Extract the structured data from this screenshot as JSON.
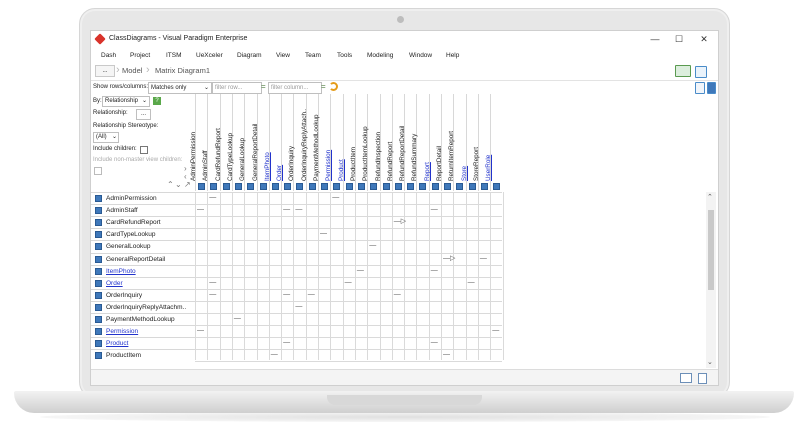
{
  "window": {
    "title": "ClassDiagrams - Visual Paradigm Enterprise",
    "minimize": "—",
    "maximize": "☐",
    "close": "✕"
  },
  "menu": [
    "Dash",
    "Project",
    "ITSM",
    "UeXceler",
    "Diagram",
    "View",
    "Team",
    "Tools",
    "Modeling",
    "Window",
    "Help"
  ],
  "breadcrumb": {
    "dots": "...",
    "items": [
      "Model",
      "Matrix Diagram1"
    ]
  },
  "filter": {
    "show_label": "Show rows/columns:",
    "show_value": "Matches only",
    "row_placeholder": "filter row...",
    "col_placeholder": "filter column...",
    "eq": "="
  },
  "panel": {
    "by_label": "By:",
    "by_value": "Relationship",
    "relationship_label": "Relationship:",
    "relationship_button": "...",
    "stereotype_label": "Relationship Stereotype:",
    "stereotype_value": "(All)",
    "include_children": "Include children:",
    "include_nonmaster": "Include non-master view children:"
  },
  "columns": [
    {
      "label": "AdminPermission",
      "link": false
    },
    {
      "label": "AdminStaff",
      "link": false
    },
    {
      "label": "CardRefundReport",
      "link": false
    },
    {
      "label": "CardTypeLookup",
      "link": false
    },
    {
      "label": "GeneralLookup",
      "link": false
    },
    {
      "label": "GeneralReportDetail",
      "link": false
    },
    {
      "label": "ItemPhoto",
      "link": true
    },
    {
      "label": "Order",
      "link": true
    },
    {
      "label": "OrderInquiry",
      "link": false
    },
    {
      "label": "OrderInquiryReplyAttach..",
      "link": false
    },
    {
      "label": "PaymentMethodLookup",
      "link": false
    },
    {
      "label": "Permission",
      "link": true
    },
    {
      "label": "Product",
      "link": true
    },
    {
      "label": "ProductItem",
      "link": false
    },
    {
      "label": "ProductItemLookup",
      "link": false
    },
    {
      "label": "RefundInspection",
      "link": false
    },
    {
      "label": "RefundReport",
      "link": false
    },
    {
      "label": "RefundReportDetail",
      "link": false
    },
    {
      "label": "RefundSummary",
      "link": false
    },
    {
      "label": "Report",
      "link": true
    },
    {
      "label": "ReportDetail",
      "link": false
    },
    {
      "label": "ReturnItemReport",
      "link": false
    },
    {
      "label": "Store",
      "link": true
    },
    {
      "label": "StoreReport",
      "link": false
    },
    {
      "label": "UserRole",
      "link": true
    }
  ],
  "rows": [
    {
      "label": "AdminPermission",
      "link": false
    },
    {
      "label": "AdminStaff",
      "link": false
    },
    {
      "label": "CardRefundReport",
      "link": false
    },
    {
      "label": "CardTypeLookup",
      "link": false
    },
    {
      "label": "GeneralLookup",
      "link": false
    },
    {
      "label": "GeneralReportDetail",
      "link": false
    },
    {
      "label": "ItemPhoto",
      "link": true
    },
    {
      "label": "Order",
      "link": true
    },
    {
      "label": "OrderInquiry",
      "link": false
    },
    {
      "label": "OrderInquiryReplyAttachm..",
      "link": false
    },
    {
      "label": "PaymentMethodLookup",
      "link": false
    },
    {
      "label": "Permission",
      "link": true
    },
    {
      "label": "Product",
      "link": true
    },
    {
      "label": "ProductItem",
      "link": false
    }
  ],
  "cells": [
    {
      "r": 0,
      "c": 1,
      "m": "line"
    },
    {
      "r": 0,
      "c": 11,
      "m": "line"
    },
    {
      "r": 1,
      "c": 0,
      "m": "line"
    },
    {
      "r": 1,
      "c": 7,
      "m": "line"
    },
    {
      "r": 1,
      "c": 8,
      "m": "line"
    },
    {
      "r": 1,
      "c": 19,
      "m": "line"
    },
    {
      "r": 2,
      "c": 16,
      "m": "arrow"
    },
    {
      "r": 3,
      "c": 10,
      "m": "line"
    },
    {
      "r": 4,
      "c": 14,
      "m": "line"
    },
    {
      "r": 5,
      "c": 20,
      "m": "arrow"
    },
    {
      "r": 5,
      "c": 23,
      "m": "line"
    },
    {
      "r": 6,
      "c": 13,
      "m": "line"
    },
    {
      "r": 6,
      "c": 19,
      "m": "line"
    },
    {
      "r": 7,
      "c": 1,
      "m": "line"
    },
    {
      "r": 7,
      "c": 12,
      "m": "line"
    },
    {
      "r": 7,
      "c": 22,
      "m": "line"
    },
    {
      "r": 8,
      "c": 1,
      "m": "line"
    },
    {
      "r": 8,
      "c": 7,
      "m": "line"
    },
    {
      "r": 8,
      "c": 9,
      "m": "line"
    },
    {
      "r": 8,
      "c": 16,
      "m": "line"
    },
    {
      "r": 9,
      "c": 8,
      "m": "line"
    },
    {
      "r": 10,
      "c": 3,
      "m": "line"
    },
    {
      "r": 11,
      "c": 0,
      "m": "line"
    },
    {
      "r": 11,
      "c": 24,
      "m": "line"
    },
    {
      "r": 12,
      "c": 7,
      "m": "line"
    },
    {
      "r": 12,
      "c": 19,
      "m": "line"
    },
    {
      "r": 13,
      "c": 6,
      "m": "line"
    },
    {
      "r": 13,
      "c": 20,
      "m": "line"
    }
  ],
  "colors": {
    "accent": "#3f78ba",
    "link": "#2233cc",
    "app_icon": "#d9332b"
  }
}
